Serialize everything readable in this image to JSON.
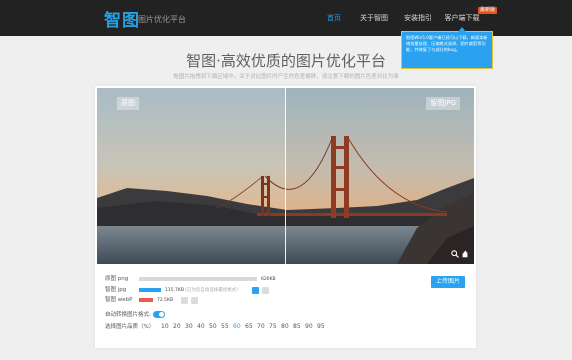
{
  "header": {
    "logo": "智图",
    "logo_sub": "图片优化平台",
    "nav": [
      {
        "label": "首页",
        "active": true
      },
      {
        "label": "关于智图",
        "active": false
      },
      {
        "label": "安装指引",
        "active": false
      },
      {
        "label": "客户端下载",
        "active": false
      }
    ],
    "badge": "最新版",
    "tip": "智图Win5.0客户端已经可以下载，新版本新增批量处理、压缩格式选择、图片裁剪等功能，并修复了与部分的bug。"
  },
  "page": {
    "title": "智图·高效优质的图片优化平台",
    "subtitle": "拖图片拖拽到下面区域中，关于对比图片时产生的色差偏移，请注意下载的图片色差对比为准"
  },
  "preview": {
    "left_label": "原图",
    "right_label": "智图JPG"
  },
  "results": [
    {
      "label": "原图 png",
      "size": "626KB",
      "note": "",
      "percent": 100,
      "color": "#d9d9d9"
    },
    {
      "label": "智图 jpg",
      "size": "115.7KB",
      "note": "(已为您自动选择最优格式)",
      "percent": 18.5,
      "color": "#2aa2f0"
    },
    {
      "label": "智图 webP",
      "size": "72.5KB",
      "note": "",
      "percent": 11.6,
      "color": "#f0584e"
    }
  ],
  "upload_button": "上传图片",
  "auto_convert_label": "自动转换图片格式:",
  "quality_label": "选择图片品质（%）",
  "quality_options": [
    "10",
    "20",
    "30",
    "40",
    "50",
    "55",
    "60",
    "65",
    "70",
    "75",
    "80",
    "85",
    "90",
    "95"
  ],
  "quality_selected": "60",
  "colors": {
    "accent": "#2aa2f0",
    "header_bg": "#222222",
    "webp_bar": "#f0584e"
  }
}
